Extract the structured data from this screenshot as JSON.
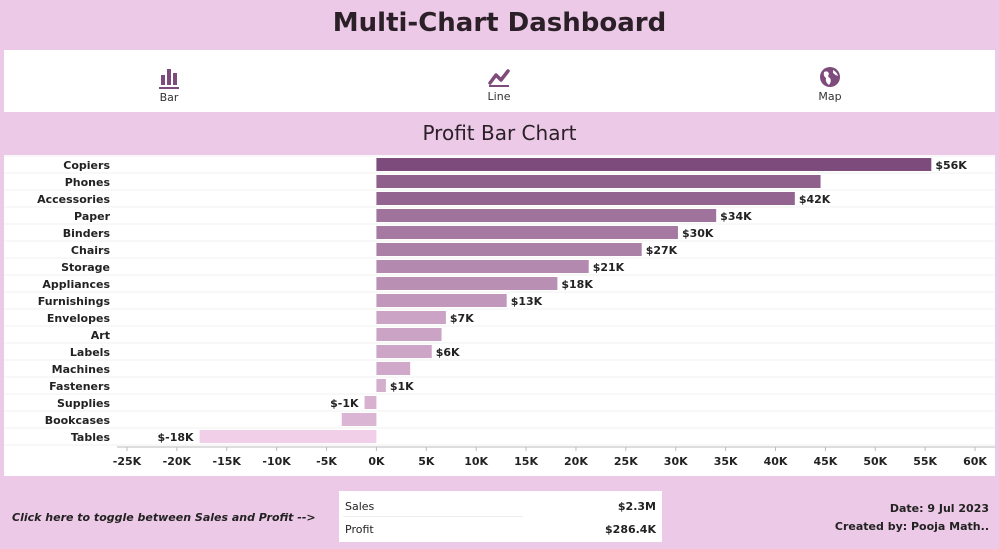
{
  "header": {
    "title": "Multi-Chart Dashboard"
  },
  "nav": {
    "items": [
      {
        "label": "Bar",
        "icon": "bar-chart-icon",
        "active": true
      },
      {
        "label": "Line",
        "icon": "line-chart-icon",
        "active": false
      },
      {
        "label": "Map",
        "icon": "globe-icon",
        "active": false
      }
    ]
  },
  "colors": {
    "background": "#ecc9e6",
    "accent": "#7d4c7c",
    "bar_dark": "#7d4c7c",
    "bar_light": "#f2cfe9"
  },
  "chart_data": {
    "type": "bar",
    "orientation": "horizontal",
    "title": "Profit Bar Chart",
    "categories": [
      "Copiers",
      "Phones",
      "Accessories",
      "Paper",
      "Binders",
      "Chairs",
      "Storage",
      "Appliances",
      "Furnishings",
      "Envelopes",
      "Art",
      "Labels",
      "Machines",
      "Fasteners",
      "Supplies",
      "Bookcases",
      "Tables"
    ],
    "values": [
      55618,
      44516,
      41937,
      34054,
      30222,
      26590,
      21279,
      18138,
      13059,
      6964,
      6528,
      5546,
      3385,
      950,
      -1189,
      -3473,
      -17725
    ],
    "data_labels": [
      "$56K",
      "",
      "$42K",
      "$34K",
      "$30K",
      "$27K",
      "$21K",
      "$18K",
      "$13K",
      "$7K",
      "",
      "$6K",
      "",
      "$1K",
      "$-1K",
      "",
      "$-18K"
    ],
    "xlim": [
      -26000,
      62000
    ],
    "xticks": [
      -25000,
      -20000,
      -15000,
      -10000,
      -5000,
      0,
      5000,
      10000,
      15000,
      20000,
      25000,
      30000,
      35000,
      40000,
      45000,
      50000,
      55000,
      60000
    ],
    "xtick_labels": [
      "-25K",
      "-20K",
      "-15K",
      "-10K",
      "-5K",
      "0K",
      "5K",
      "10K",
      "15K",
      "20K",
      "25K",
      "30K",
      "35K",
      "40K",
      "45K",
      "50K",
      "55K",
      "60K"
    ],
    "grid": false
  },
  "footer": {
    "toggle_text": "Click here to toggle between Sales and Profit -->",
    "kpi": [
      {
        "label": "Sales",
        "value": "$2.3M"
      },
      {
        "label": "Profit",
        "value": "$286.4K"
      }
    ],
    "date": "Date: 9 Jul 2023",
    "created_by": "Created by: Pooja Math.."
  }
}
